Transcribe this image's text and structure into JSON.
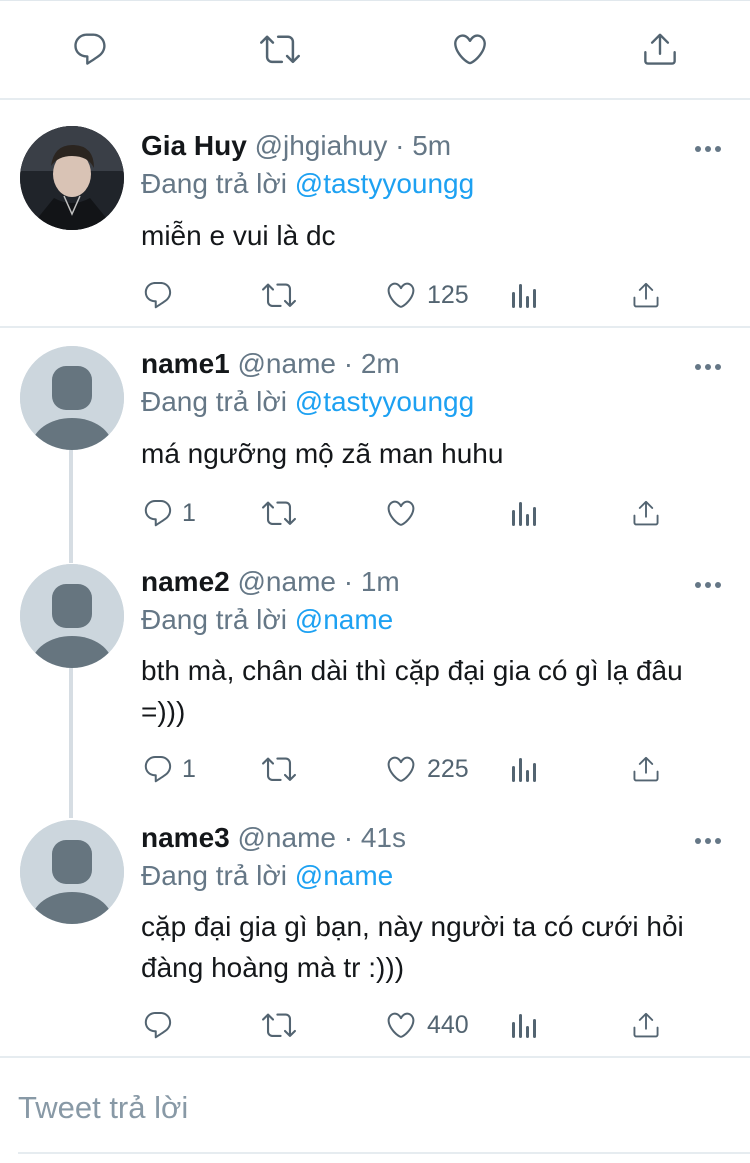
{
  "top_actions": {
    "icons": [
      "reply-icon",
      "retweet-icon",
      "like-icon",
      "share-icon"
    ]
  },
  "tweets": [
    {
      "name": "Gia Huy",
      "handle": "@jhgiahuy",
      "time": "· 5m",
      "reply_prefix": "Đang trả lời",
      "reply_to": "@tastyyoungg",
      "text": "miễn e vui là dc",
      "replies": "",
      "likes": "125",
      "avatar": "photo"
    },
    {
      "name": "name1",
      "handle": "@name",
      "time": "· 2m",
      "reply_prefix": "Đang trả lời",
      "reply_to": "@tastyyoungg",
      "text": "má ngưỡng mộ zã man huhu",
      "replies": "1",
      "likes": "",
      "avatar": "default"
    },
    {
      "name": "name2",
      "handle": "@name",
      "time": "· 1m",
      "reply_prefix": "Đang trả lời",
      "reply_to": "@name",
      "text": "bth mà, chân dài thì cặp đại gia có gì lạ đâu =)))",
      "replies": "1",
      "likes": "225",
      "avatar": "default"
    },
    {
      "name": "name3",
      "handle": "@name",
      "time": "· 41s",
      "reply_prefix": "Đang trả lời",
      "reply_to": "@name",
      "text": "cặp đại gia gì bạn, này người ta có cưới hỏi đàng hoàng mà tr :)))",
      "replies": "",
      "likes": "440",
      "avatar": "default"
    }
  ],
  "composer": {
    "placeholder": "Tweet trả lời"
  },
  "colors": {
    "accent": "#1da1f2",
    "muted": "#657786",
    "icon": "#536471",
    "divider": "#e6ecf0"
  }
}
